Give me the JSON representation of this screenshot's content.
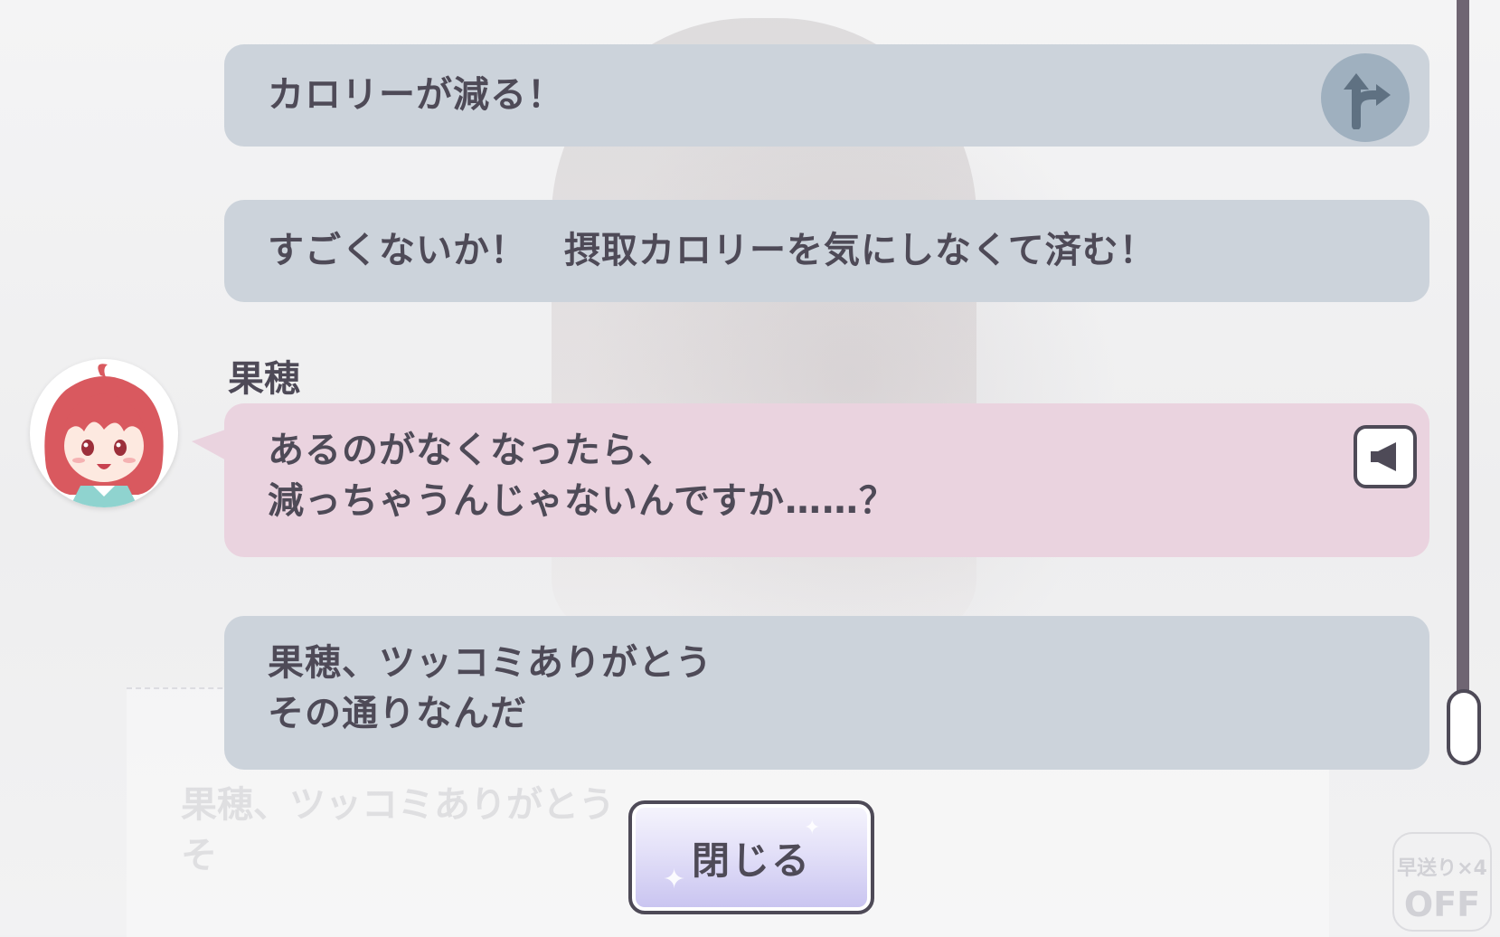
{
  "log": {
    "entries": [
      {
        "type": "choice",
        "text": "カロリーが減る！",
        "icon": "branch-arrow-icon"
      },
      {
        "type": "choice",
        "text": "すごくないか！　摂取カロリーを気にしなくて済む！"
      },
      {
        "type": "speech",
        "speaker": "果穂",
        "text": "あるのがなくなったら、\n減っちゃうんじゃないんですか……？",
        "icon": "speaker-voice-icon"
      },
      {
        "type": "choice",
        "text": "果穂、ツッコミありがとう\nその通りなんだ"
      }
    ]
  },
  "background": {
    "ghost_text": "果穂、ツッコミありがとう\nそ",
    "fastforward_label": "早送り×4",
    "fastforward_state": "OFF"
  },
  "close_button": {
    "label": "閉じる"
  },
  "colors": {
    "choice_bubble": "#ccd3db",
    "speech_bubble": "#ead3df",
    "text": "#4e4a57",
    "scrollbar": "#6f6572",
    "branch_icon_bg": "#9fb0bf",
    "avatar_hair": "#d9595f"
  }
}
